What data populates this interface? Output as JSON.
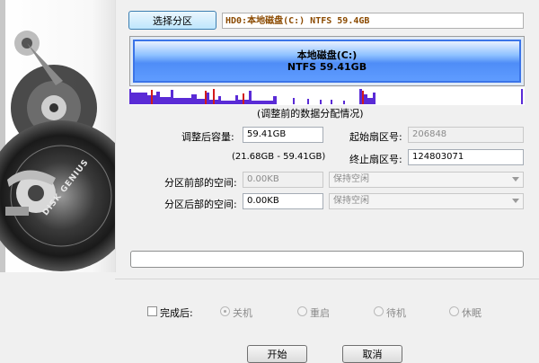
{
  "toolbar": {
    "select_partition_label": "选择分区"
  },
  "disk": {
    "label": "HD0:本地磁盘(C:) NTFS 59.4GB"
  },
  "partition_bar": {
    "name": "本地磁盘(C:)",
    "info": "NTFS 59.41GB"
  },
  "data_distribution_caption": "(调整前的数据分配情况)",
  "resize": {
    "size_label": "调整后容量:",
    "size_value": "59.41GB",
    "range_text": "(21.68GB - 59.41GB)",
    "start_sector_label": "起始扇区号:",
    "start_sector_value": "206848",
    "end_sector_label": "终止扇区号:",
    "end_sector_value": "124803071",
    "space_before_label": "分区前部的空间:",
    "space_before_value": "0.00KB",
    "space_before_option": "保持空闲",
    "space_after_label": "分区后部的空间:",
    "space_after_value": "0.00KB",
    "space_after_option": "保持空闲"
  },
  "on_complete": {
    "label": "完成后:",
    "options": [
      "关机",
      "重启",
      "待机",
      "休眠"
    ],
    "selected": "关机"
  },
  "buttons": {
    "start": "开始",
    "cancel": "取消"
  },
  "artwork": {
    "brand": "DISK GENIUS"
  },
  "colors": {
    "partition_blue": "#4f8df7",
    "distribution_purple": "#5a2bd6",
    "distribution_red": "#d21b1b"
  }
}
